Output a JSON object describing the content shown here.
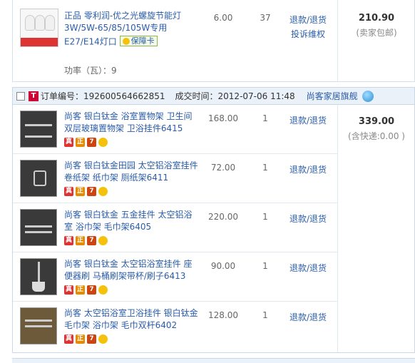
{
  "top_item": {
    "title": "正品 零利润-优之光螺旋节能灯 3W/5W-65/85/105W专用 E27/E14灯口",
    "guarantee": "保障卡",
    "meta": "功率（瓦）：9",
    "price": "6.00",
    "qty": "37",
    "refund": "退款/退货",
    "complaint": "投诉维权",
    "total": "210.90",
    "total_note": "(卖家包邮)"
  },
  "order": {
    "t_icon": "T",
    "order_no": "订单编号：192600564662851",
    "deal_time": "成交时间：2012-07-06 11:48",
    "shop": "尚客家居旗舰",
    "total": "339.00",
    "total_note": "(含快递:0.00 )",
    "items": [
      {
        "title": "尚客 银白钛金 浴室置物架 卫生间双层玻璃置物架 卫浴挂件6415",
        "price": "168.00",
        "qty": "1",
        "action": "退款/退货"
      },
      {
        "title": "尚客 银白钛金田园 太空铝浴室挂件 卷纸架 纸巾架 厕纸架6411",
        "price": "72.00",
        "qty": "1",
        "action": "退款/退货"
      },
      {
        "title": "尚客 银白钛金 五金挂件 太空铝浴室 浴巾架 毛巾架6405",
        "price": "220.00",
        "qty": "1",
        "action": "退款/退货"
      },
      {
        "title": "尚客 银白钛金 太空铝浴室挂件 座便器刷 马桶刷架带杯/刷子6413",
        "price": "90.00",
        "qty": "1",
        "action": "退款/退货"
      },
      {
        "title": "尚客 太空铝浴室卫浴挂件 银白钛金 毛巾架 浴巾架 毛巾双杆6402",
        "price": "128.00",
        "qty": "1",
        "action": "退款/退货"
      }
    ],
    "badges": [
      "真",
      "正",
      "7",
      ""
    ]
  },
  "colors": {
    "link": "#2a5caa",
    "header_bg": "#eaf1f8",
    "border": "#c9d7e6"
  },
  "icons": {
    "order_icon": "tmall-t-icon",
    "chat": "wangwang-icon",
    "checkbox": "checkbox-icon"
  }
}
